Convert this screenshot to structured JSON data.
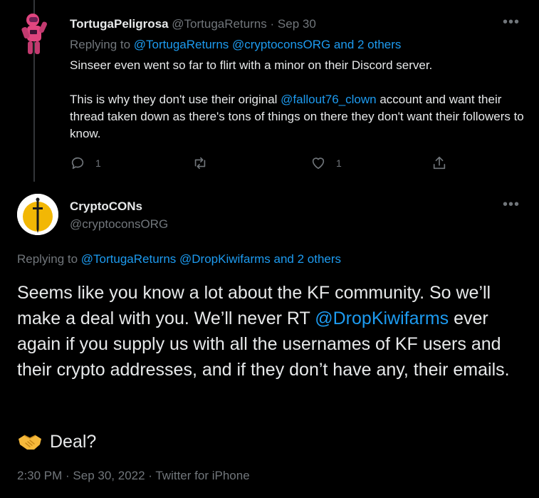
{
  "tweet1": {
    "display_name": "TortugaPeligrosa",
    "handle": "@TortugaReturns",
    "separator": "·",
    "date": "Sep 30",
    "more": "•••",
    "replying_prefix": "Replying to",
    "replying_mentions": "@TortugaReturns @cryptoconsORG and 2 others",
    "body_line1": "Sinseer even went so far to flirt with a minor on their Discord server.",
    "body_p2_before": "This is why they don't use their original ",
    "body_p2_mention": "@fallout76_clown",
    "body_p2_after": " account and want their thread taken down as there's tons of things on there they don't want their followers to know.",
    "actions": {
      "reply_count": "1",
      "retweet_count": "",
      "like_count": "1"
    }
  },
  "tweet2": {
    "display_name": "CryptoCONs",
    "handle": "@cryptoconsORG",
    "more": "•••",
    "replying_prefix": "Replying to",
    "replying_mentions": "@TortugaReturns @DropKiwifarms and 2 others",
    "body_before": "Seems like you know a lot about the KF community. So we’ll make a deal with you. We’ll never RT ",
    "body_mention": "@DropKiwifarms",
    "body_after": " ever again if you supply us with all the usernames of KF users and their crypto addresses, and if they don’t have any, their emails.",
    "deal_text": "Deal?",
    "meta": "2:30 PM · Sep 30, 2022 · Twitter for iPhone"
  },
  "colors": {
    "background": "#000000",
    "text": "#e7e9ea",
    "secondary": "#71767b",
    "link": "#1d9bf0"
  }
}
